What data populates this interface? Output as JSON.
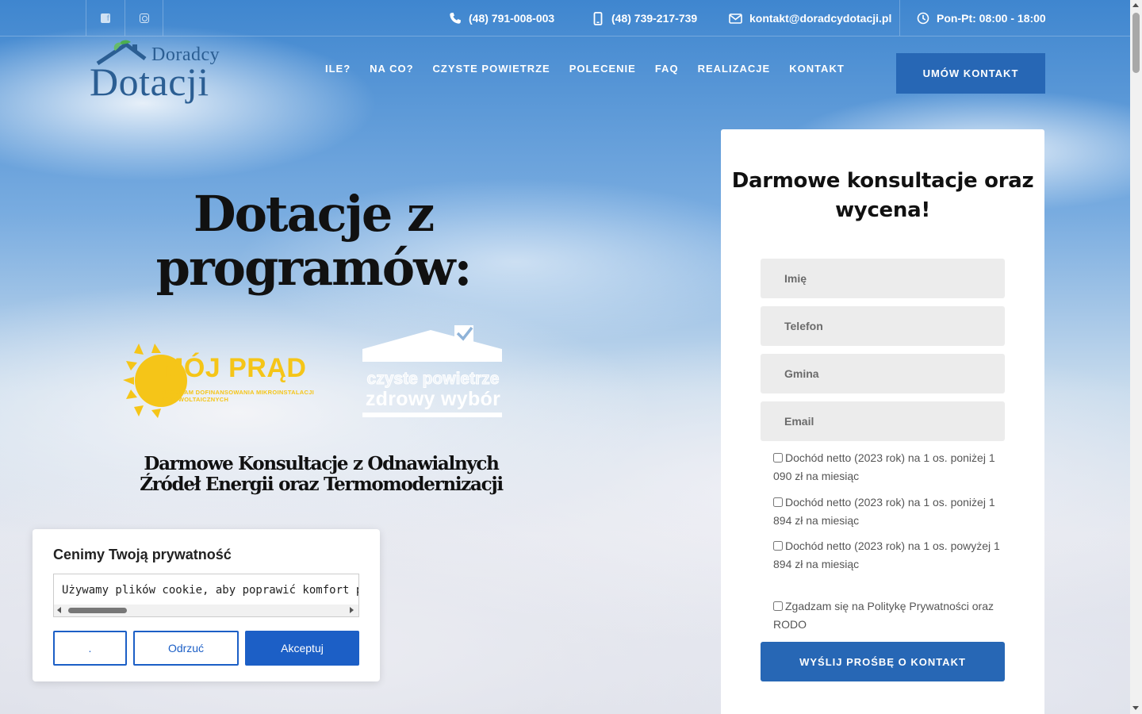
{
  "topbar": {
    "phone1": "(48) 791-008-003",
    "phone2": "(48) 739-217-739",
    "email": "kontakt@doradcydotacji.pl",
    "hours": "Pon-Pt: 08:00 - 18:00"
  },
  "logo": {
    "top": "Doradcy",
    "main": "Dotacji"
  },
  "nav": {
    "items": [
      "ILE?",
      "NA CO?",
      "CZYSTE POWIETRZE",
      "POLECENIE",
      "FAQ",
      "REALIZACJE",
      "KONTAKT"
    ],
    "cta": "UMÓW KONTAKT"
  },
  "hero": {
    "title": "Dotacje z programów:",
    "program1": {
      "name": "MÓJ PRĄD",
      "subtitle": "PROGRAM DOFINANSOWANIA MIKROINSTALACJI FOTOWOLTAICZNYCH"
    },
    "program2": {
      "line1": "czyste powietrze",
      "line2": "zdrowy wybór"
    },
    "subtitle": "Darmowe Konsultacje z Odnawialnych Źródeł Energii oraz Termomodernizacji"
  },
  "form": {
    "title": "Darmowe konsultacje oraz wycena!",
    "placeholders": {
      "name": "Imię",
      "phone": "Telefon",
      "commune": "Gmina",
      "email": "Email"
    },
    "income_options": [
      "Dochód netto (2023 rok) na 1 os. poniżej 1 090 zł na miesiąc",
      "Dochód netto (2023 rok) na 1 os. poniżej 1 894 zł na miesiąc",
      "Dochód netto (2023 rok) na 1 os. powyżej 1 894 zł na miesiąc"
    ],
    "consent": "Zgadzam się na Politykę Prywatności oraz RODO",
    "submit": "WYŚLIJ PROŚBĘ O KONTAKT"
  },
  "cookie": {
    "title": "Cenimy Twoją prywatność",
    "text": "Używamy plików cookie, aby poprawić komfort przeglądania",
    "btn_settings": ".",
    "btn_reject": "Odrzuć",
    "btn_accept": "Akceptuj"
  },
  "colors": {
    "brand_blue": "#2767b5",
    "cookie_blue": "#1c5fc6",
    "logo_blue": "#2b5e93",
    "sun_yellow": "#f5c518"
  },
  "icons": [
    "facebook-icon",
    "instagram-icon",
    "phone-icon",
    "mobile-icon",
    "mail-icon",
    "clock-icon"
  ]
}
